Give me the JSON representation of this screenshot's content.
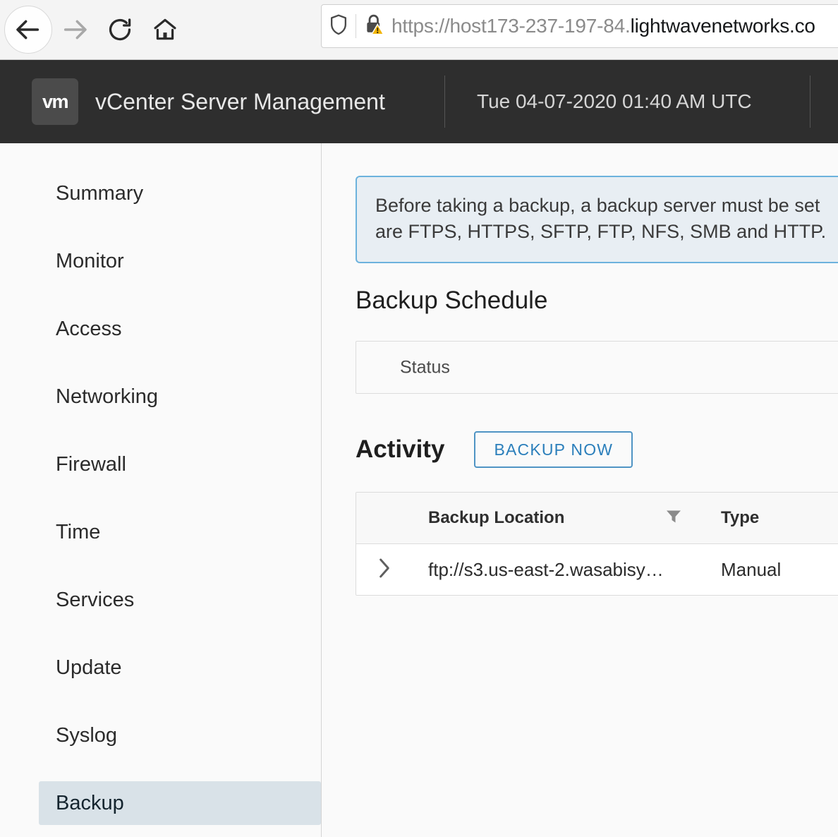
{
  "browser": {
    "back_icon": "arrow-left-icon",
    "forward_icon": "arrow-right-icon",
    "reload_icon": "reload-icon",
    "home_icon": "home-icon",
    "shield_icon": "shield-icon",
    "lock_warning_icon": "lock-warning-icon",
    "url_prefix": "https://host173-237-197-84.",
    "url_domain": "lightwavenetworks.co"
  },
  "header": {
    "logo_text": "vm",
    "title": "vCenter Server Management",
    "timestamp": "Tue 04-07-2020 01:40 AM UTC"
  },
  "sidebar": {
    "items": [
      {
        "label": "Summary",
        "selected": false
      },
      {
        "label": "Monitor",
        "selected": false
      },
      {
        "label": "Access",
        "selected": false
      },
      {
        "label": "Networking",
        "selected": false
      },
      {
        "label": "Firewall",
        "selected": false
      },
      {
        "label": "Time",
        "selected": false
      },
      {
        "label": "Services",
        "selected": false
      },
      {
        "label": "Update",
        "selected": false
      },
      {
        "label": "Syslog",
        "selected": false
      },
      {
        "label": "Backup",
        "selected": true
      }
    ]
  },
  "main": {
    "banner": {
      "line1": "Before taking a backup, a backup server must be set",
      "line2": "are FTPS, HTTPS, SFTP, FTP, NFS, SMB and HTTP."
    },
    "backup_schedule": {
      "title": "Backup Schedule",
      "status_label": "Status"
    },
    "activity": {
      "title": "Activity",
      "backup_now_label": "BACKUP NOW",
      "table": {
        "columns": [
          "Backup Location",
          "Type"
        ],
        "rows": [
          {
            "expand_icon": "chevron-right-icon",
            "location": "ftp://s3.us-east-2.wasabisy…",
            "type": "Manual"
          }
        ]
      }
    }
  },
  "colors": {
    "header_bg": "#2e2e2e",
    "accent_blue": "#2b7fbb",
    "banner_border": "#6cb2dd",
    "banner_bg": "#e8eef3",
    "selected_bg": "#d9e2e8"
  }
}
